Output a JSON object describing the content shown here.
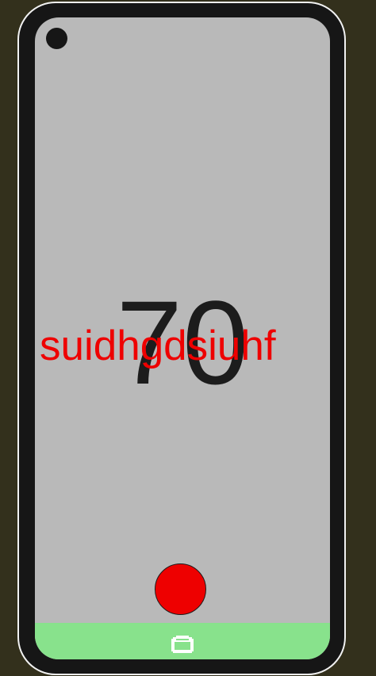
{
  "display": {
    "number": "70",
    "overlay_text": "suidhgdsiuhf"
  },
  "icons": {
    "camera": "camera-dot-icon",
    "record": "record-button-icon",
    "home": "home-icon"
  },
  "colors": {
    "background": "#33301c",
    "device_frame": "#161616",
    "screen": "#b9b9b9",
    "number_text": "#1c1c1c",
    "overlay_text": "#ee0000",
    "record_button": "#ee0000",
    "bottom_bar": "#88e28c"
  }
}
